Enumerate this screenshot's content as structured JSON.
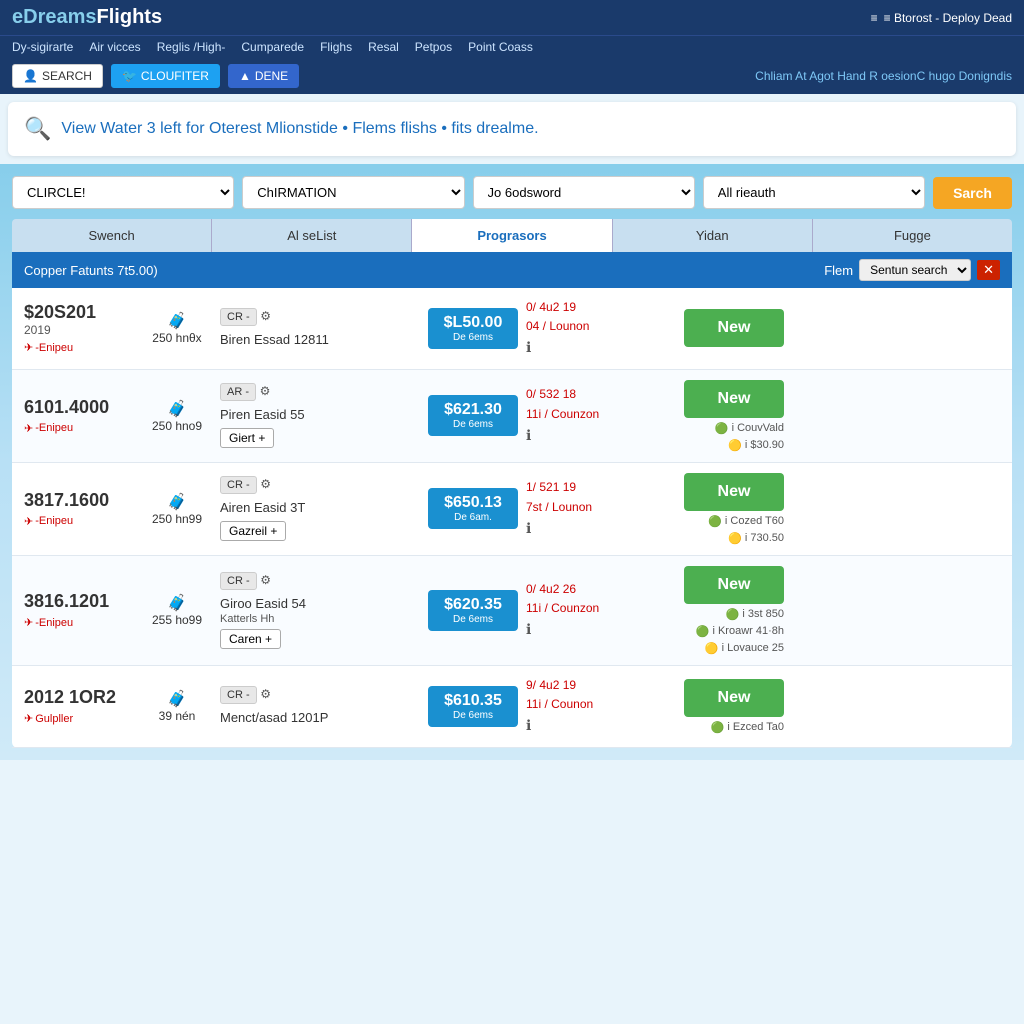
{
  "header": {
    "logo_edreams": "eDreams",
    "logo_flights": "Flights",
    "top_right": "≡ Btorost - Deploy Dead"
  },
  "nav": {
    "items": [
      "Dy-sigirarte",
      "Air vicces",
      "Reglis /High-",
      "Cumparede",
      "Flighs",
      "Resal",
      "Petpos",
      "Point Coass"
    ]
  },
  "action_bar": {
    "search_btn": "SEARCH",
    "cloud_btn": "CLOUFITER",
    "dene_btn": "DENE",
    "right_text": "Chliam At Agot Hand R oesionC hugo Donigndis"
  },
  "search_banner": {
    "text": "View Water 3 left for Oterest Mlionstide • Flems flishs • fits drealme."
  },
  "filters": {
    "dropdown1": {
      "label": "CLIRCLE!",
      "options": [
        "CLIRCLE!"
      ]
    },
    "dropdown2": {
      "label": "ChIRMATION",
      "options": [
        "ChIRMATION"
      ]
    },
    "dropdown3": {
      "label": "Jo 6odsword",
      "options": [
        "Jo 6odsword"
      ]
    },
    "dropdown4": {
      "label": "All rieauth",
      "options": [
        "All rieauth"
      ]
    },
    "search_btn": "Sarch"
  },
  "tabs": [
    {
      "label": "Swench",
      "active": false
    },
    {
      "label": "Al seList",
      "active": false
    },
    {
      "label": "Prograsors",
      "active": true
    },
    {
      "label": "Yidan",
      "active": false
    },
    {
      "label": "Fugge",
      "active": false
    }
  ],
  "results": {
    "header_text": "Copper Fatunts 7t5.00)",
    "filter_label": "Flem",
    "filter_select": "Sentun search",
    "close_btn": "✕",
    "rows": [
      {
        "price": "$20S201",
        "year": "2019",
        "airline": "-Enipeu",
        "hours": "250 hnθx",
        "flight_code": "CR -",
        "flight_name": "Biren Essad 12811",
        "extra": "",
        "add_btn": null,
        "fare_price": "$L50.00",
        "fare_label": "De 6ems",
        "stops": "0/ 4u2 19",
        "stops2": "04 / Lounon",
        "new_btn": "New",
        "coupons": []
      },
      {
        "price": "6101.4000",
        "year": "",
        "airline": "-Enipeu",
        "hours": "250 hno9",
        "flight_code": "AR -",
        "flight_name": "Piren Easid 55",
        "extra": "",
        "add_btn": "Giert +",
        "fare_price": "$621.30",
        "fare_label": "De 6ems",
        "stops": "0/ 532 18",
        "stops2": "11i / Counzon",
        "new_btn": "New",
        "coupons": [
          {
            "color": "green",
            "text": "i CouvVald"
          },
          {
            "color": "orange",
            "text": "i $30.90"
          }
        ]
      },
      {
        "price": "3817.1600",
        "year": "",
        "airline": "-Enipeu",
        "hours": "250 hn99",
        "flight_code": "CR -",
        "flight_name": "Airen Easid 3T",
        "extra": "",
        "add_btn": "Gazreil +",
        "fare_price": "$650.13",
        "fare_label": "De 6am.",
        "stops": "1/ 521 19",
        "stops2": "7st / Lounon",
        "new_btn": "New",
        "coupons": [
          {
            "color": "green",
            "text": "i Cozed T60"
          },
          {
            "color": "orange",
            "text": "i 730.50"
          }
        ]
      },
      {
        "price": "3816.1201",
        "year": "",
        "airline": "-Enipeu",
        "hours": "255 ho99",
        "flight_code": "CR -",
        "flight_name": "Giroo Easid 54",
        "extra": "Katterls Hh",
        "add_btn": "Caren +",
        "fare_price": "$620.35",
        "fare_label": "De 6ems",
        "stops": "0/ 4u2 26",
        "stops2": "11i / Counzon",
        "new_btn": "New",
        "coupons": [
          {
            "color": "green",
            "text": "i 3st 850"
          },
          {
            "color": "green",
            "text": "i Kroawr 41·8h"
          },
          {
            "color": "orange",
            "text": "i Lovauce 25"
          }
        ]
      },
      {
        "price": "2012 1OR2",
        "year": "",
        "airline": "Gulpller",
        "hours": "39 nén",
        "flight_code": "CR -",
        "flight_name": "Menct/asad 1201P",
        "extra": "",
        "add_btn": null,
        "fare_price": "$610.35",
        "fare_label": "De 6ems",
        "stops": "9/ 4u2 19",
        "stops2": "11i / Counon",
        "new_btn": "New",
        "coupons": [
          {
            "color": "green",
            "text": "i Ezced Ta0"
          }
        ]
      }
    ]
  }
}
